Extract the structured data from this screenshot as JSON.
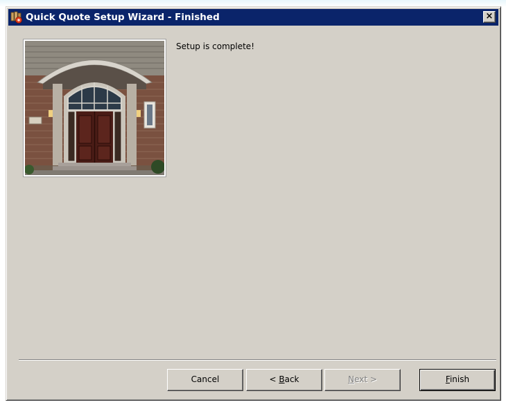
{
  "window": {
    "title": "Quick Quote Setup Wizard - Finished",
    "title_icon": "wizard-app-icon",
    "close_label": "×"
  },
  "content": {
    "message": "Setup is complete!",
    "image": "front-door-photo"
  },
  "buttons": {
    "cancel": {
      "label": "Cancel"
    },
    "back": {
      "prefix": "< ",
      "accel": "B",
      "rest": "ack",
      "enabled": true
    },
    "next": {
      "accel": "N",
      "rest": "ext >",
      "enabled": false
    },
    "finish": {
      "accel": "F",
      "rest": "inish",
      "enabled": true
    }
  },
  "colors": {
    "titlebar": "#0a246a",
    "dialog_face": "#d4d0c8",
    "disabled_text": "#808080"
  }
}
